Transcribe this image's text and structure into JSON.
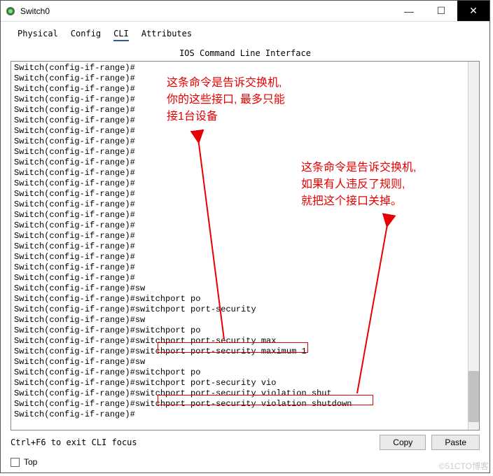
{
  "titlebar": {
    "title": "Switch0",
    "min_icon": "—",
    "max_icon": "☐",
    "close_icon": "✕"
  },
  "tabs": {
    "physical": "Physical",
    "config": "Config",
    "cli": "CLI",
    "attributes": "Attributes"
  },
  "subtitle": "IOS Command Line Interface",
  "cli_lines": [
    "Switch(config-if-range)#",
    "Switch(config-if-range)#",
    "Switch(config-if-range)#",
    "Switch(config-if-range)#",
    "Switch(config-if-range)#",
    "Switch(config-if-range)#",
    "Switch(config-if-range)#",
    "Switch(config-if-range)#",
    "Switch(config-if-range)#",
    "Switch(config-if-range)#",
    "Switch(config-if-range)#",
    "Switch(config-if-range)#",
    "Switch(config-if-range)#",
    "Switch(config-if-range)#",
    "Switch(config-if-range)#",
    "Switch(config-if-range)#",
    "Switch(config-if-range)#",
    "Switch(config-if-range)#",
    "Switch(config-if-range)#",
    "Switch(config-if-range)#",
    "Switch(config-if-range)#",
    "Switch(config-if-range)#sw",
    "Switch(config-if-range)#switchport po",
    "Switch(config-if-range)#switchport port-security",
    "Switch(config-if-range)#sw",
    "Switch(config-if-range)#switchport po",
    "Switch(config-if-range)#switchport port-security max",
    "Switch(config-if-range)#switchport port-security maximum 1",
    "Switch(config-if-range)#sw",
    "Switch(config-if-range)#switchport po",
    "Switch(config-if-range)#switchport port-security vio",
    "Switch(config-if-range)#switchport port-security violation shut",
    "Switch(config-if-range)#switchport port-security violation shutdown",
    "Switch(config-if-range)#"
  ],
  "hint": "Ctrl+F6 to exit CLI focus",
  "buttons": {
    "copy": "Copy",
    "paste": "Paste"
  },
  "footer": {
    "top": "Top"
  },
  "annotations": {
    "anno1_line1": "这条命令是告诉交换机,",
    "anno1_line2": "你的这些接口, 最多只能",
    "anno1_line3": "接1台设备",
    "anno2_line1": "这条命令是告诉交换机,",
    "anno2_line2": "如果有人违反了规则,",
    "anno2_line3": "就把这个接口关掉。"
  },
  "watermark": "©51CTO博客"
}
